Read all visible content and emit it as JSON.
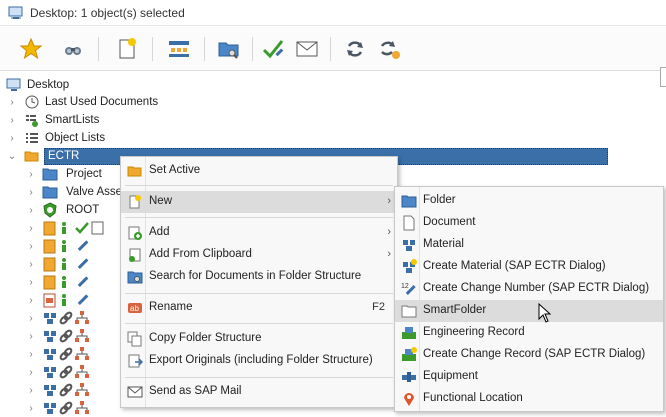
{
  "window": {
    "title": "Desktop: 1 object(s) selected"
  },
  "toolbar": {
    "buttons": [
      {
        "name": "favorites-star-button"
      },
      {
        "name": "binoculars-search-button"
      },
      {
        "name": "new-document-button"
      },
      {
        "name": "structure-button"
      },
      {
        "name": "folder-search-button"
      },
      {
        "name": "edit-check-button"
      },
      {
        "name": "send-mail-button"
      },
      {
        "name": "refresh-button"
      },
      {
        "name": "refresh-settings-button"
      }
    ]
  },
  "tree": {
    "root_label": "Desktop",
    "items": [
      {
        "label": "Last Used Documents"
      },
      {
        "label": "SmartLists"
      },
      {
        "label": "Object Lists"
      },
      {
        "label": "ECTR"
      }
    ],
    "ectr_children": [
      {
        "label": "Project"
      },
      {
        "label": "Valve Asse"
      },
      {
        "label": "ROOT"
      }
    ]
  },
  "context_menu": {
    "items": [
      {
        "label": "Set Active"
      },
      {
        "label": "New"
      },
      {
        "label": "Add"
      },
      {
        "label": "Add From Clipboard"
      },
      {
        "label": "Search for Documents in Folder Structure"
      },
      {
        "label": "Rename",
        "shortcut": "F2"
      },
      {
        "label": "Copy Folder Structure"
      },
      {
        "label": "Export Originals (including Folder Structure)"
      },
      {
        "label": "Send as SAP Mail"
      }
    ]
  },
  "submenu_new": {
    "items": [
      {
        "label": "Folder"
      },
      {
        "label": "Document"
      },
      {
        "label": "Material"
      },
      {
        "label": "Create Material (SAP ECTR Dialog)"
      },
      {
        "label": "Create Change Number (SAP ECTR Dialog)"
      },
      {
        "label": "SmartFolder"
      },
      {
        "label": "Engineering Record"
      },
      {
        "label": "Create Change Record (SAP ECTR Dialog)"
      },
      {
        "label": "Equipment"
      },
      {
        "label": "Functional Location"
      }
    ]
  },
  "colors": {
    "selection": "#3b6fa8",
    "folder": "#f0a830",
    "blue_folder": "#4a86c8",
    "accent_green": "#3a9a2a"
  }
}
